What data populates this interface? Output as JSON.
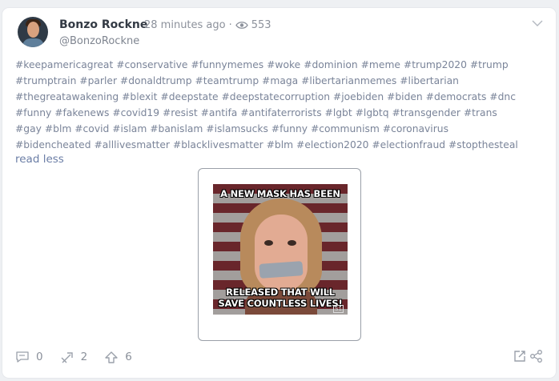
{
  "post": {
    "author": "Bonzo Rockne",
    "time": "28 minutes ago",
    "separator": "·",
    "views": "553",
    "handle": "@BonzoRockne",
    "hashtags": "#keepamericagreat #conservative #funnymemes #woke #dominion #meme #trump2020 #trump #trumptrain #parler #donaldtrump #teamtrump #maga #libertarianmemes #libertarian #thegreatawakening #blexit #deepstate #deepstatecorruption #joebiden #biden #democrats #dnc #funny #fakenews #covid19 #resist #antifa #antifaterrorists #lgbt #lgbtq #transgender #trans #gay #blm #covid #islam #banislam #islamsucks #funny #communism #coronavirus #bidencheated #alllivesmatter #blacklivesmatter #blm #election2020 #electionfraud #stopthesteal",
    "read_less": "read less",
    "meme": {
      "top_text": "A NEW MASK HAS BEEN",
      "bottom_text": "RELEASED THAT WILL SAVE COUNTLESS LIVES!",
      "corner_mark": "S1"
    },
    "actions": {
      "comments": "0",
      "reposts": "2",
      "upvotes": "6"
    }
  },
  "icons": {
    "views": "eye-icon",
    "menu": "chevron-down-icon",
    "comment": "comment-icon",
    "repost": "repost-icon",
    "upvote": "upvote-icon",
    "embed": "embed-icon",
    "share": "share-icon"
  },
  "colors": {
    "hashtag": "#7a8499",
    "link": "#6b7ea6",
    "meta": "#8c919b"
  }
}
